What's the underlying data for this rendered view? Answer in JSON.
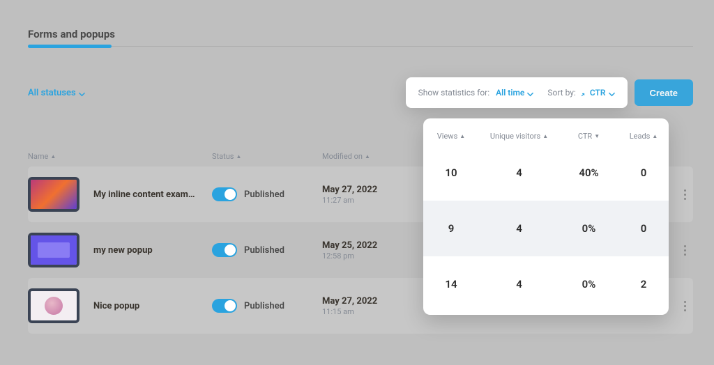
{
  "header": {
    "title": "Forms and popups"
  },
  "toolbar": {
    "filter_label": "All statuses",
    "show_stats_label": "Show statistics for:",
    "show_stats_value": "All time",
    "sort_label": "Sort by:",
    "sort_value": "CTR",
    "create_label": "Create"
  },
  "table": {
    "columns": {
      "name": "Name",
      "status": "Status",
      "modified": "Modified on",
      "views": "Views",
      "uniq": "Unique visitors",
      "ctr": "CTR",
      "leads": "Leads"
    },
    "rows": [
      {
        "name": "My inline content example",
        "status": "Published",
        "date": "May 27, 2022",
        "time": "11:27 am",
        "views": "10",
        "uniq": "4",
        "ctr": "40%",
        "leads": "0"
      },
      {
        "name": "my new popup",
        "status": "Published",
        "date": "May 25, 2022",
        "time": "12:58 pm",
        "views": "9",
        "uniq": "4",
        "ctr": "0%",
        "leads": "0"
      },
      {
        "name": "Nice popup",
        "status": "Published",
        "date": "May 27, 2022",
        "time": "11:15 am",
        "views": "14",
        "uniq": "4",
        "ctr": "0%",
        "leads": "2"
      }
    ]
  },
  "colors": {
    "accent": "#2aa3df"
  }
}
